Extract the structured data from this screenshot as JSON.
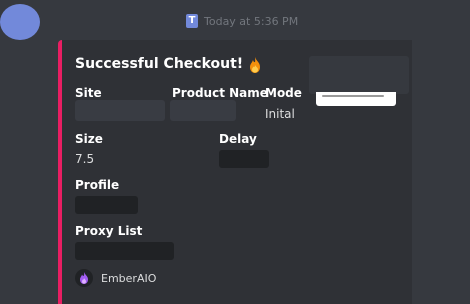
{
  "header": {
    "bot_badge": "T",
    "timestamp": "Today at 5:36 PM"
  },
  "embed": {
    "accent_color": "#e91e63",
    "title": "Successful Checkout!",
    "title_icon": "fire-icon",
    "fields": {
      "site": {
        "name": "Site",
        "value": ""
      },
      "product_name": {
        "name": "Product Name",
        "value": ""
      },
      "mode": {
        "name": "Mode",
        "value": "Inital"
      },
      "size": {
        "name": "Size",
        "value": "7.5"
      },
      "delay": {
        "name": "Delay",
        "value": ""
      },
      "profile": {
        "name": "Profile",
        "value": ""
      },
      "proxy_list": {
        "name": "Proxy List",
        "value": ""
      }
    },
    "footer": {
      "icon": "ember-flame-icon",
      "text": "EmberAIO"
    }
  }
}
